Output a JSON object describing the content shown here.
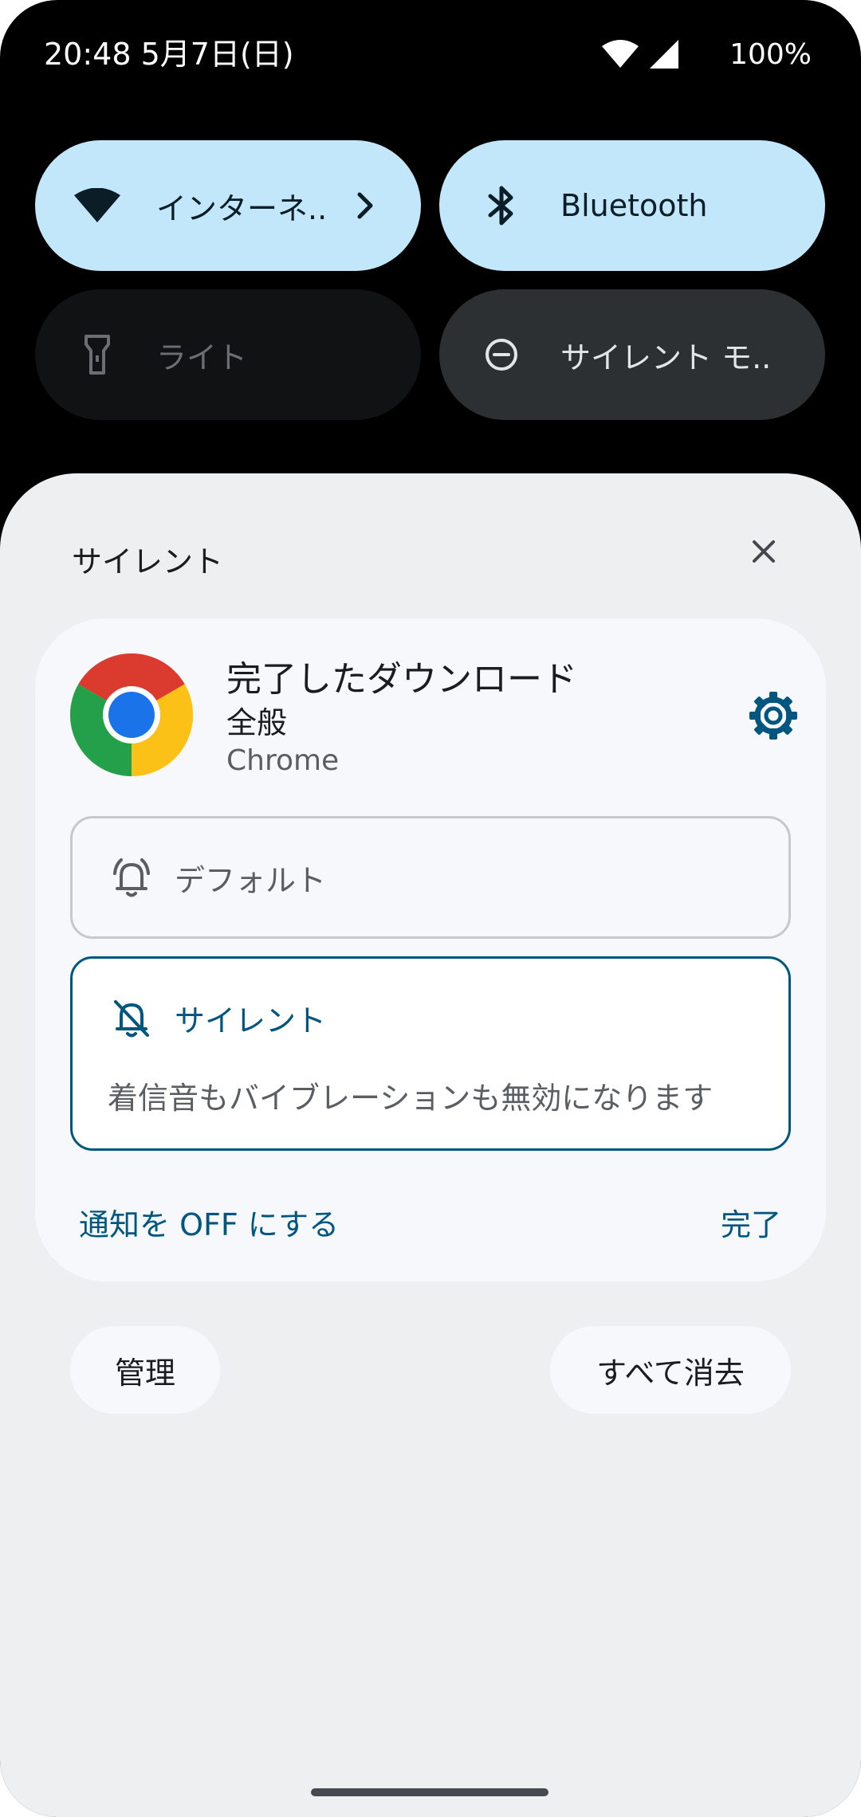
{
  "status_bar": {
    "time": "20:48 5月7日(日)",
    "battery": "100%",
    "wifi_icon": "wifi-icon",
    "signal_icon": "cell-signal-icon"
  },
  "quick_settings": {
    "tiles": [
      {
        "label": "インターネ..",
        "state": "on",
        "icon": "wifi-icon"
      },
      {
        "label": "Bluetooth",
        "state": "on",
        "icon": "bluetooth-icon"
      },
      {
        "label": "ライト",
        "state": "unavailable",
        "icon": "flashlight-icon"
      },
      {
        "label": "サイレント モ..",
        "state": "off",
        "icon": "do-not-disturb-icon"
      }
    ]
  },
  "shade": {
    "section_title": "サイレント",
    "notification": {
      "title": "完了したダウンロード",
      "channel": "全般",
      "app": "Chrome",
      "options": {
        "default_label": "デフォルト",
        "silent_label": "サイレント",
        "silent_description": "着信音もバイブレーションも無効になります"
      },
      "turn_off_label": "通知を OFF にする",
      "done_label": "完了"
    },
    "manage_label": "管理",
    "clear_all_label": "すべて消去"
  },
  "colors": {
    "tile_on": "#c2e7fa",
    "tile_off": "#2d3033",
    "accent": "#00567e",
    "shade_bg": "#eeeff1",
    "card_bg": "#f6f8fb"
  }
}
